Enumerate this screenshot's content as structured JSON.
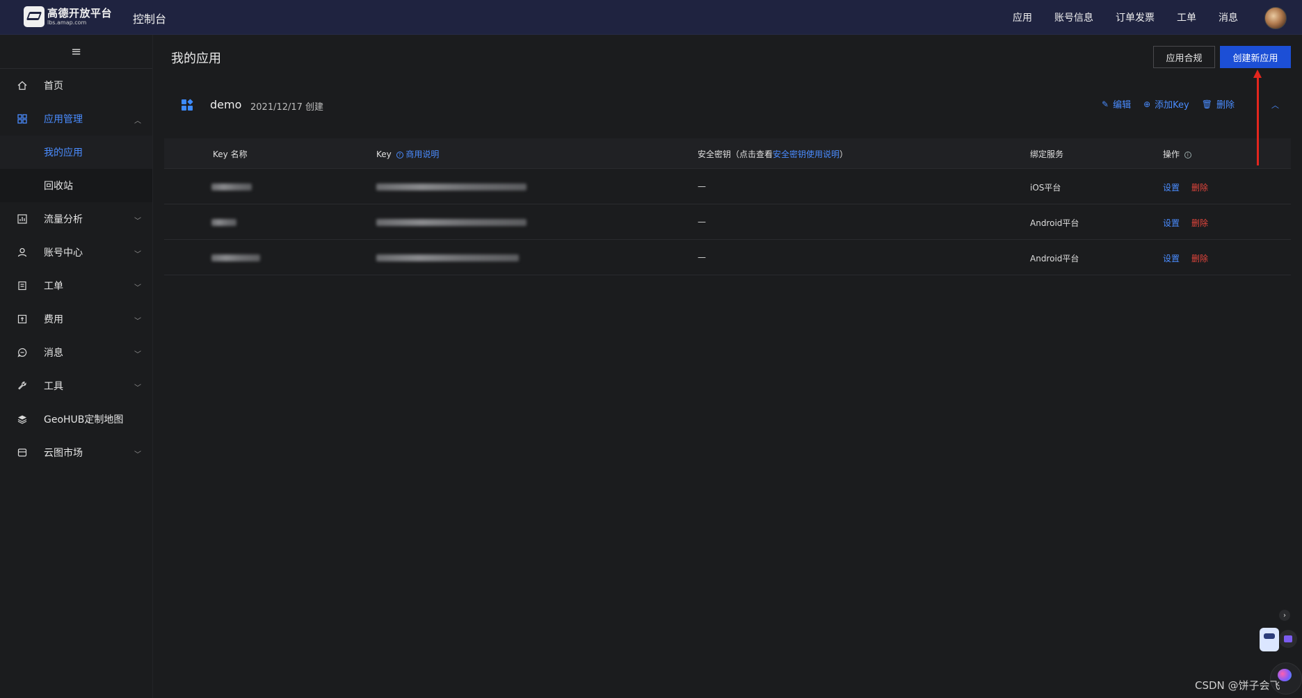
{
  "topbar": {
    "logo_main": "高德开放平台",
    "logo_sub": "lbs.amap.com",
    "console": "控制台",
    "nav": [
      "应用",
      "账号信息",
      "订单发票",
      "工单",
      "消息"
    ]
  },
  "sidebar": {
    "collapse_icon": "≡",
    "items": [
      {
        "label": "首页",
        "icon": "home-icon"
      },
      {
        "label": "应用管理",
        "icon": "apps-icon"
      },
      {
        "label": "我的应用"
      },
      {
        "label": "回收站"
      },
      {
        "label": "流量分析",
        "icon": "chart-icon"
      },
      {
        "label": "账号中心",
        "icon": "user-icon"
      },
      {
        "label": "工单",
        "icon": "ticket-icon"
      },
      {
        "label": "费用",
        "icon": "billing-icon"
      },
      {
        "label": "消息",
        "icon": "message-icon"
      },
      {
        "label": "工具",
        "icon": "wrench-icon"
      },
      {
        "label": "GeoHUB定制地图",
        "icon": "layers-icon"
      },
      {
        "label": "云图市场",
        "icon": "store-icon"
      }
    ]
  },
  "main": {
    "title": "我的应用",
    "btn_compliance": "应用合规",
    "btn_create": "创建新应用",
    "app": {
      "name": "demo",
      "date": "2021/12/17 创建",
      "actions": {
        "edit": "编辑",
        "add_key": "添加Key",
        "delete": "删除"
      }
    },
    "table": {
      "headers": {
        "key_name": "Key 名称",
        "key": "Key",
        "key_link": "商用说明",
        "secret": "安全密钥（点击查看",
        "secret_link": "安全密钥使用说明",
        "secret_end": "）",
        "service": "绑定服务",
        "ops": "操作"
      },
      "rows": [
        {
          "secret": "—",
          "service": "iOS平台",
          "set": "设置",
          "del": "删除"
        },
        {
          "secret": "—",
          "service": "Android平台",
          "set": "设置",
          "del": "删除"
        },
        {
          "secret": "—",
          "service": "Android平台",
          "set": "设置",
          "del": "删除"
        }
      ]
    }
  },
  "watermark": "CSDN @饼子会飞",
  "colors": {
    "accent": "#4a8cff",
    "primary_button": "#1c4fd6",
    "danger": "#e2453c",
    "annotation": "#e3261e"
  }
}
